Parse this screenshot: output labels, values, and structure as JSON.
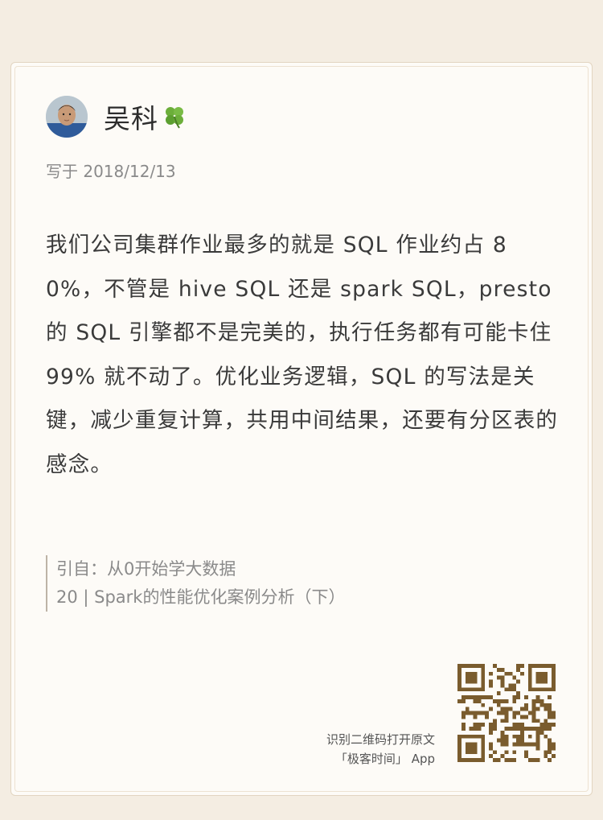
{
  "author": {
    "name": "吴科",
    "emoji_icon": "four-leaf-clover-icon"
  },
  "date": "写于 2018/12/13",
  "content": "我们公司集群作业最多的就是 SQL 作业约占 80%，不管是 hive SQL 还是 spark SQL，presto 的 SQL 引擎都不是完美的，执行任务都有可能卡住 99% 就不动了。优化业务逻辑，SQL 的写法是关键，减少重复计算，共用中间结果，还要有分区表的感念。",
  "quote": {
    "source_line": "引自：从0开始学大数据",
    "article_line": "20 | Spark的性能优化案例分析（下）"
  },
  "qr": {
    "line1": "识别二维码打开原文",
    "line2": "「极客时间」 App"
  },
  "colors": {
    "background": "#f4ede2",
    "card": "#fdfbf7",
    "qr_brown": "#7a5c2e",
    "text": "#3a3a3a",
    "muted": "#8a8a8a"
  }
}
